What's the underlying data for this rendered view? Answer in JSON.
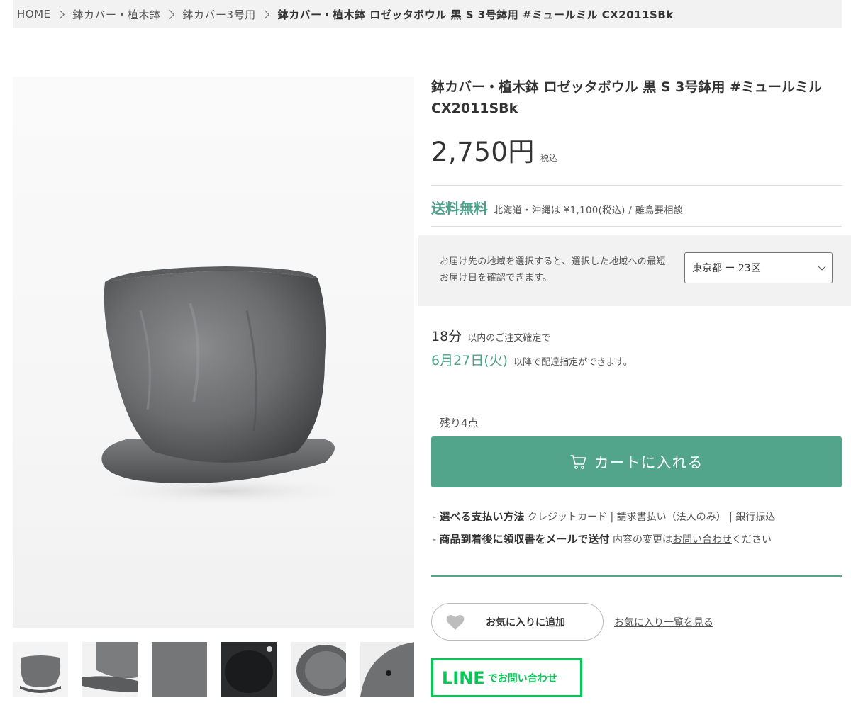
{
  "breadcrumb": {
    "home": "HOME",
    "cat1": "鉢カバー・植木鉢",
    "cat2": "鉢カバー3号用",
    "current": "鉢カバー・植木鉢 ロゼッタボウル 黒 S 3号鉢用 #ミュールミル CX2011SBk"
  },
  "product": {
    "title": "鉢カバー・植木鉢 ロゼッタボウル 黒 S 3号鉢用 #ミュールミル CX2011SBk",
    "price": "2,750円",
    "tax": "税込"
  },
  "shipping": {
    "free": "送料無料",
    "note": "北海道・沖縄は ¥1,100(税込) / 離島要相談"
  },
  "region": {
    "text": "お届け先の地域を選択すると、選択した地域への最短お届け日を確認できます。",
    "selected": "東京都 ー 23区"
  },
  "delivery": {
    "minutes": "18分",
    "minutes_note": "以内のご注文確定で",
    "date": "6月27日(火)",
    "date_note": "以降で配達指定ができます。"
  },
  "stock": "残り4点",
  "cart_button": "カートに入れる",
  "payment": {
    "dash": "-",
    "label": "選べる支払い方法",
    "credit": "クレジットカード",
    "others": "| 請求書払い（法人のみ） | 銀行振込"
  },
  "receipt": {
    "dash": "-",
    "label": "商品到着後に領収書をメールで送付",
    "note_pre": "内容の変更は",
    "note_link": "お問い合わせ",
    "note_post": "ください"
  },
  "favorite": {
    "add": "お気に入りに追加",
    "list": "お気に入り一覧を見る"
  },
  "line": {
    "logo": "LINE",
    "text": "でお問い合わせ"
  },
  "colors": {
    "accent": "#52a58b",
    "line_green": "#06c755"
  },
  "icons": [
    "chevron-right-icon",
    "chevron-down-icon",
    "cart-icon",
    "heart-icon"
  ]
}
